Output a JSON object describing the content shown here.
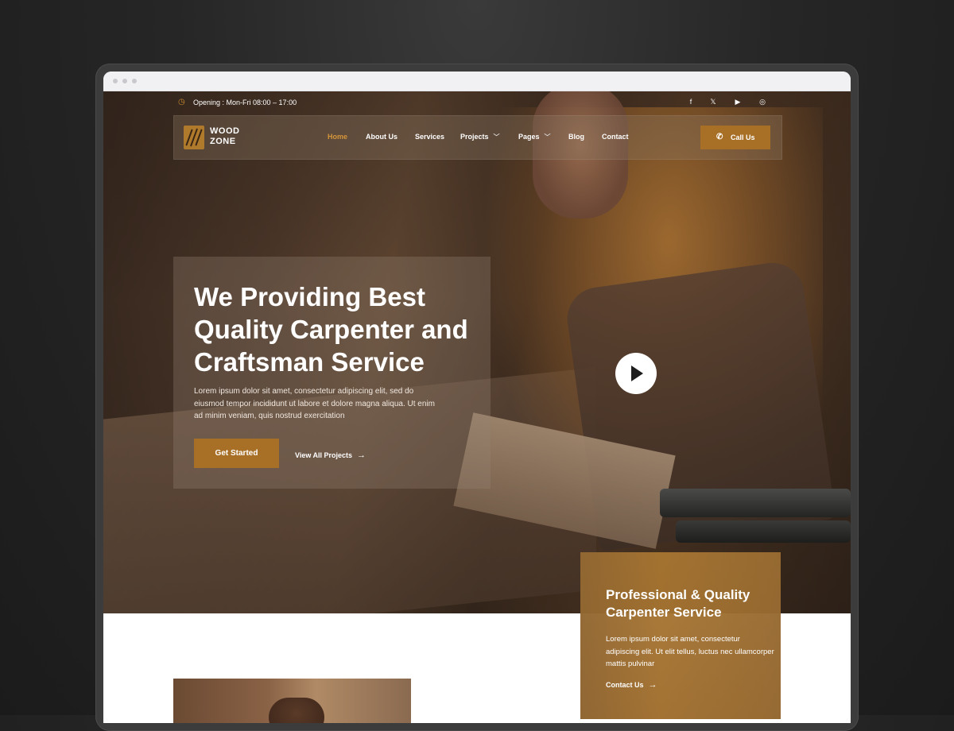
{
  "topbar": {
    "opening_hours": "Opening : Mon-Fri 08:00 – 17:00",
    "clock_icon": "clock-icon",
    "social_icons": [
      "facebook-icon",
      "x-icon",
      "youtube-icon",
      "instagram-icon"
    ],
    "social_glyphs": [
      "f",
      "𝕏",
      "▶",
      "◎"
    ]
  },
  "brand": {
    "name_line1": "WOOD",
    "name_line2": "ZONE",
    "accent_color": "#a87027"
  },
  "nav": {
    "items": [
      {
        "label": "Home",
        "active": true
      },
      {
        "label": "About Us"
      },
      {
        "label": "Services"
      },
      {
        "label": "Projects",
        "dropdown": true
      },
      {
        "label": "Pages",
        "dropdown": true
      },
      {
        "label": "Blog"
      },
      {
        "label": "Contact"
      }
    ],
    "call_button": "Call Us"
  },
  "hero": {
    "title": "We Providing Best Quality Carpenter and Craftsman Service",
    "description": "Lorem ipsum dolor sit amet, consectetur adipiscing elit, sed do eiusmod tempor incididunt ut labore et dolore magna aliqua. Ut enim ad minim veniam, quis nostrud exercitation",
    "primary_button": "Get Started",
    "secondary_link": "View All Projects"
  },
  "feature_card": {
    "title": "Professional & Quality Carpenter Service",
    "description": "Lorem ipsum dolor sit amet, consectetur adipiscing elit. Ut elit tellus, luctus nec ullamcorper mattis pulvinar",
    "link": "Contact Us"
  }
}
